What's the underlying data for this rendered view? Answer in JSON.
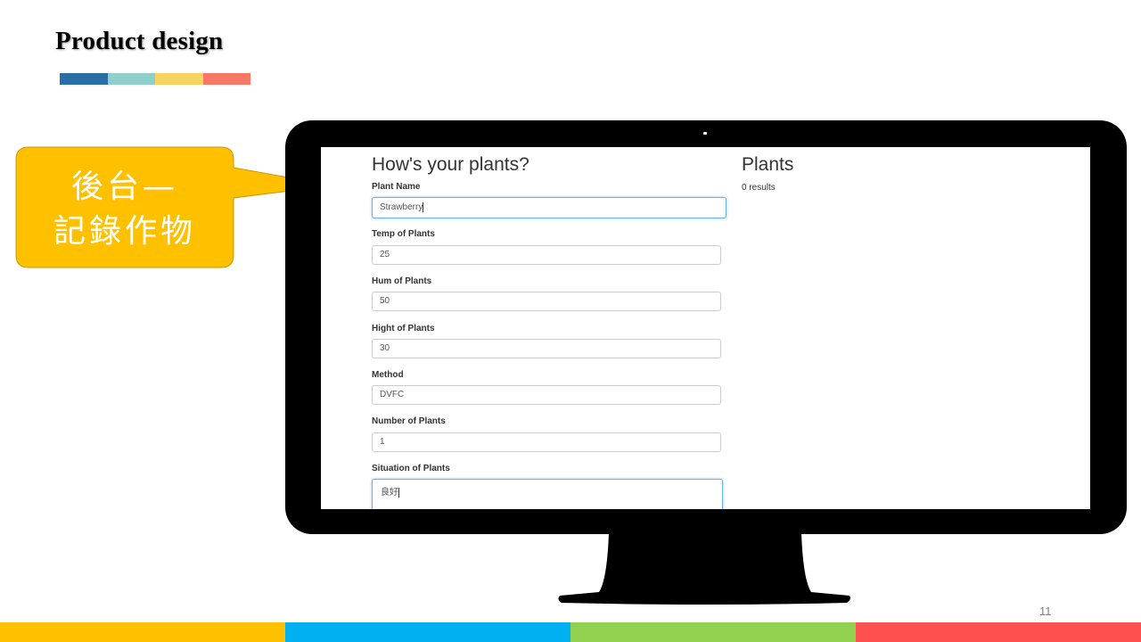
{
  "slide": {
    "title": "Product design",
    "page_number": "11",
    "title_bar_colors": [
      "#2A6EA6",
      "#8ECFC9",
      "#FAD461",
      "#F87868"
    ],
    "footer_colors": [
      "#FFC000",
      "#00B0F0",
      "#92D050",
      "#FF5050"
    ]
  },
  "callout": {
    "line1": "後台—",
    "line2": "記錄作物",
    "fill_color": "#FFC000"
  },
  "app": {
    "form": {
      "heading": "How's your plants?",
      "fields": [
        {
          "label": "Plant Name",
          "value": "Strawberry"
        },
        {
          "label": "Temp of Plants",
          "value": "25"
        },
        {
          "label": "Hum of Plants",
          "value": "50"
        },
        {
          "label": "Hight of Plants",
          "value": "30"
        },
        {
          "label": "Method",
          "value": "DVFC"
        },
        {
          "label": "Number of Plants",
          "value": "1"
        },
        {
          "label": "Situation of Plants",
          "value": "良好"
        }
      ]
    },
    "list": {
      "heading": "Plants",
      "count_text": "0 results"
    }
  }
}
